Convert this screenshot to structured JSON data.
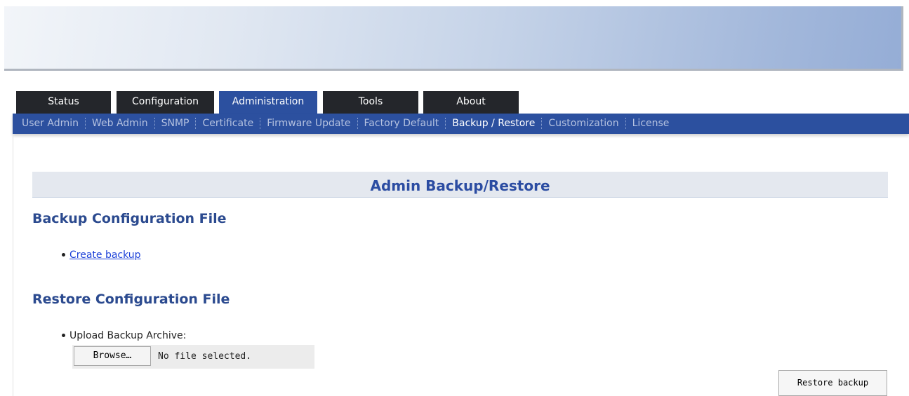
{
  "tabs": [
    {
      "label": "Status",
      "active": false
    },
    {
      "label": "Configuration",
      "active": false
    },
    {
      "label": "Administration",
      "active": true
    },
    {
      "label": "Tools",
      "active": false
    },
    {
      "label": "About",
      "active": false
    }
  ],
  "subnav": [
    {
      "label": "User Admin",
      "active": false
    },
    {
      "label": "Web Admin",
      "active": false
    },
    {
      "label": "SNMP",
      "active": false
    },
    {
      "label": "Certificate",
      "active": false
    },
    {
      "label": "Firmware Update",
      "active": false
    },
    {
      "label": "Factory Default",
      "active": false
    },
    {
      "label": "Backup / Restore",
      "active": true
    },
    {
      "label": "Customization",
      "active": false
    },
    {
      "label": "License",
      "active": false
    }
  ],
  "page": {
    "title": "Admin Backup/Restore",
    "backup_heading": "Backup Configuration File",
    "create_backup_link": "Create backup",
    "restore_heading": "Restore Configuration File",
    "upload_label": "Upload Backup Archive:",
    "browse_label": "Browse…",
    "file_status": "No file selected.",
    "restore_button": "Restore backup"
  },
  "colors": {
    "nav_blue": "#2c509f",
    "tab_dark": "#24262b",
    "heading_blue": "#2b4a8f",
    "link_blue": "#1a3fd8"
  }
}
